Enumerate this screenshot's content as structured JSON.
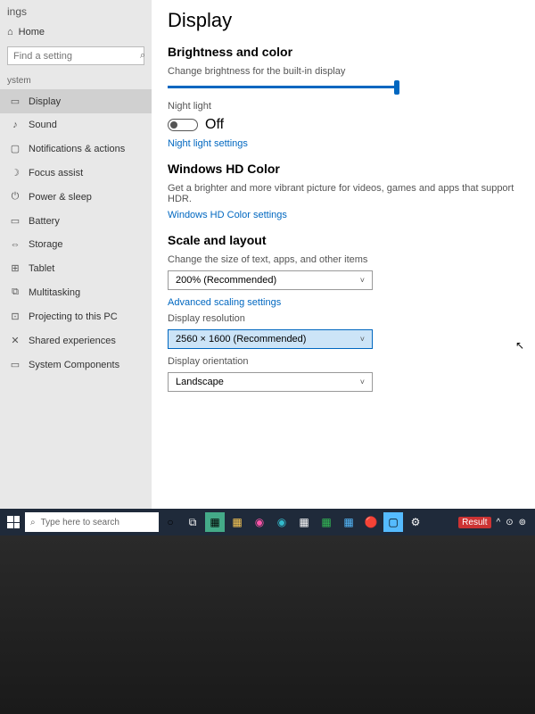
{
  "sidebar": {
    "appTitle": "ings",
    "home": "Home",
    "searchPlaceholder": "Find a setting",
    "category": "ystem",
    "items": [
      {
        "icon": "▭",
        "label": "Display"
      },
      {
        "icon": "♪",
        "label": "Sound"
      },
      {
        "icon": "▢",
        "label": "Notifications & actions"
      },
      {
        "icon": "☽",
        "label": "Focus assist"
      },
      {
        "icon": "⏻",
        "label": "Power & sleep"
      },
      {
        "icon": "▭",
        "label": "Battery"
      },
      {
        "icon": "⇔",
        "label": "Storage"
      },
      {
        "icon": "⊞",
        "label": "Tablet"
      },
      {
        "icon": "⧉",
        "label": "Multitasking"
      },
      {
        "icon": "⊡",
        "label": "Projecting to this PC"
      },
      {
        "icon": "✕",
        "label": "Shared experiences"
      },
      {
        "icon": "▭",
        "label": "System Components"
      }
    ]
  },
  "main": {
    "title": "Display",
    "brightness": {
      "heading": "Brightness and color",
      "sliderLabel": "Change brightness for the built-in display",
      "nightLightLabel": "Night light",
      "nightLightState": "Off",
      "nightLightLink": "Night light settings"
    },
    "hdColor": {
      "heading": "Windows HD Color",
      "desc": "Get a brighter and more vibrant picture for videos, games and apps that support HDR.",
      "link": "Windows HD Color settings"
    },
    "scale": {
      "heading": "Scale and layout",
      "textSizeLabel": "Change the size of text, apps, and other items",
      "textSizeValue": "200% (Recommended)",
      "advLink": "Advanced scaling settings",
      "resLabel": "Display resolution",
      "resValue": "2560 × 1600 (Recommended)",
      "orientLabel": "Display orientation",
      "orientValue": "Landscape"
    }
  },
  "taskbar": {
    "search": "Type here to search",
    "result": "Result"
  }
}
